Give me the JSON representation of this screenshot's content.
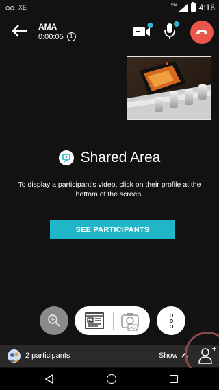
{
  "status_bar": {
    "left_text": "XE",
    "network_label": "4G",
    "time": "4:16"
  },
  "call": {
    "title": "AMA",
    "timer": "0:00:05",
    "info_glyph": "i"
  },
  "shared_area": {
    "title": "Shared Area",
    "description": "To display a participant's video, click on their profile at the bottom of the screen.",
    "button_label": "SEE PARTICIPANTS"
  },
  "participants_bar": {
    "count_label": "2 participants",
    "toggle_label": "Show"
  },
  "colors": {
    "accent": "#1fb6c9",
    "hangup": "#e9574a",
    "background": "#121212",
    "bar": "#2a2a2a"
  },
  "icons": [
    "glasses-icon",
    "signal-icon",
    "battery-icon",
    "back-arrow-icon",
    "info-icon",
    "whiteboard-icon",
    "microphone-icon",
    "hangup-icon",
    "shared-area-icon",
    "zoom-icon",
    "gallery-icon",
    "camera-icon",
    "more-icon",
    "participants-avatar-icon",
    "chevron-up-icon",
    "add-participant-icon",
    "nav-back-icon",
    "nav-home-icon",
    "nav-recents-icon"
  ]
}
